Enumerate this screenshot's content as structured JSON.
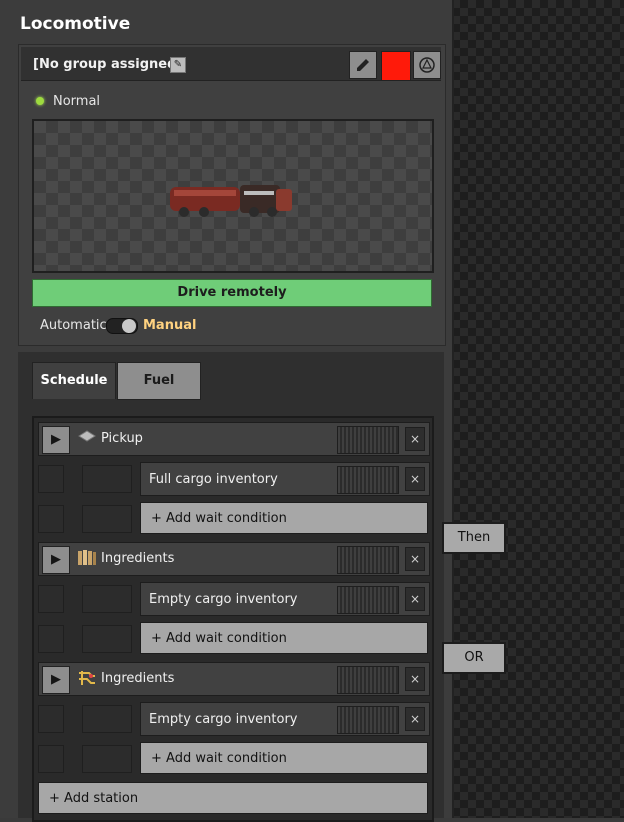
{
  "window": {
    "title": "Locomotive"
  },
  "group": {
    "label": "[No group assigned]",
    "edit_icon": "pencil-icon",
    "picker_icon": "eyedropper-icon",
    "color": "#ff1a0a",
    "center_icon": "gps-target-icon"
  },
  "status": {
    "text": "Normal",
    "color": "#9edb3f"
  },
  "drive": {
    "label": "Drive remotely"
  },
  "mode": {
    "automatic": "Automatic",
    "manual": "Manual",
    "selected": "Manual"
  },
  "tabs": [
    {
      "label": "Schedule",
      "active": true
    },
    {
      "label": "Fuel",
      "active": false
    }
  ],
  "schedule": {
    "stations": [
      {
        "name": "Pickup",
        "icon": "plate-icon",
        "conditions": [
          "Full cargo inventory"
        ]
      },
      {
        "name": "Ingredients",
        "icon": "ingredients-icon",
        "conditions": [
          "Empty cargo inventory"
        ]
      },
      {
        "name": "Ingredients",
        "icon": "circuit-icon",
        "conditions": [
          "Empty cargo inventory"
        ]
      }
    ],
    "add_wait_label": "+ Add wait condition",
    "add_station_label": "+ Add station"
  },
  "logic": {
    "then_label": "Then",
    "or_label": "OR"
  }
}
